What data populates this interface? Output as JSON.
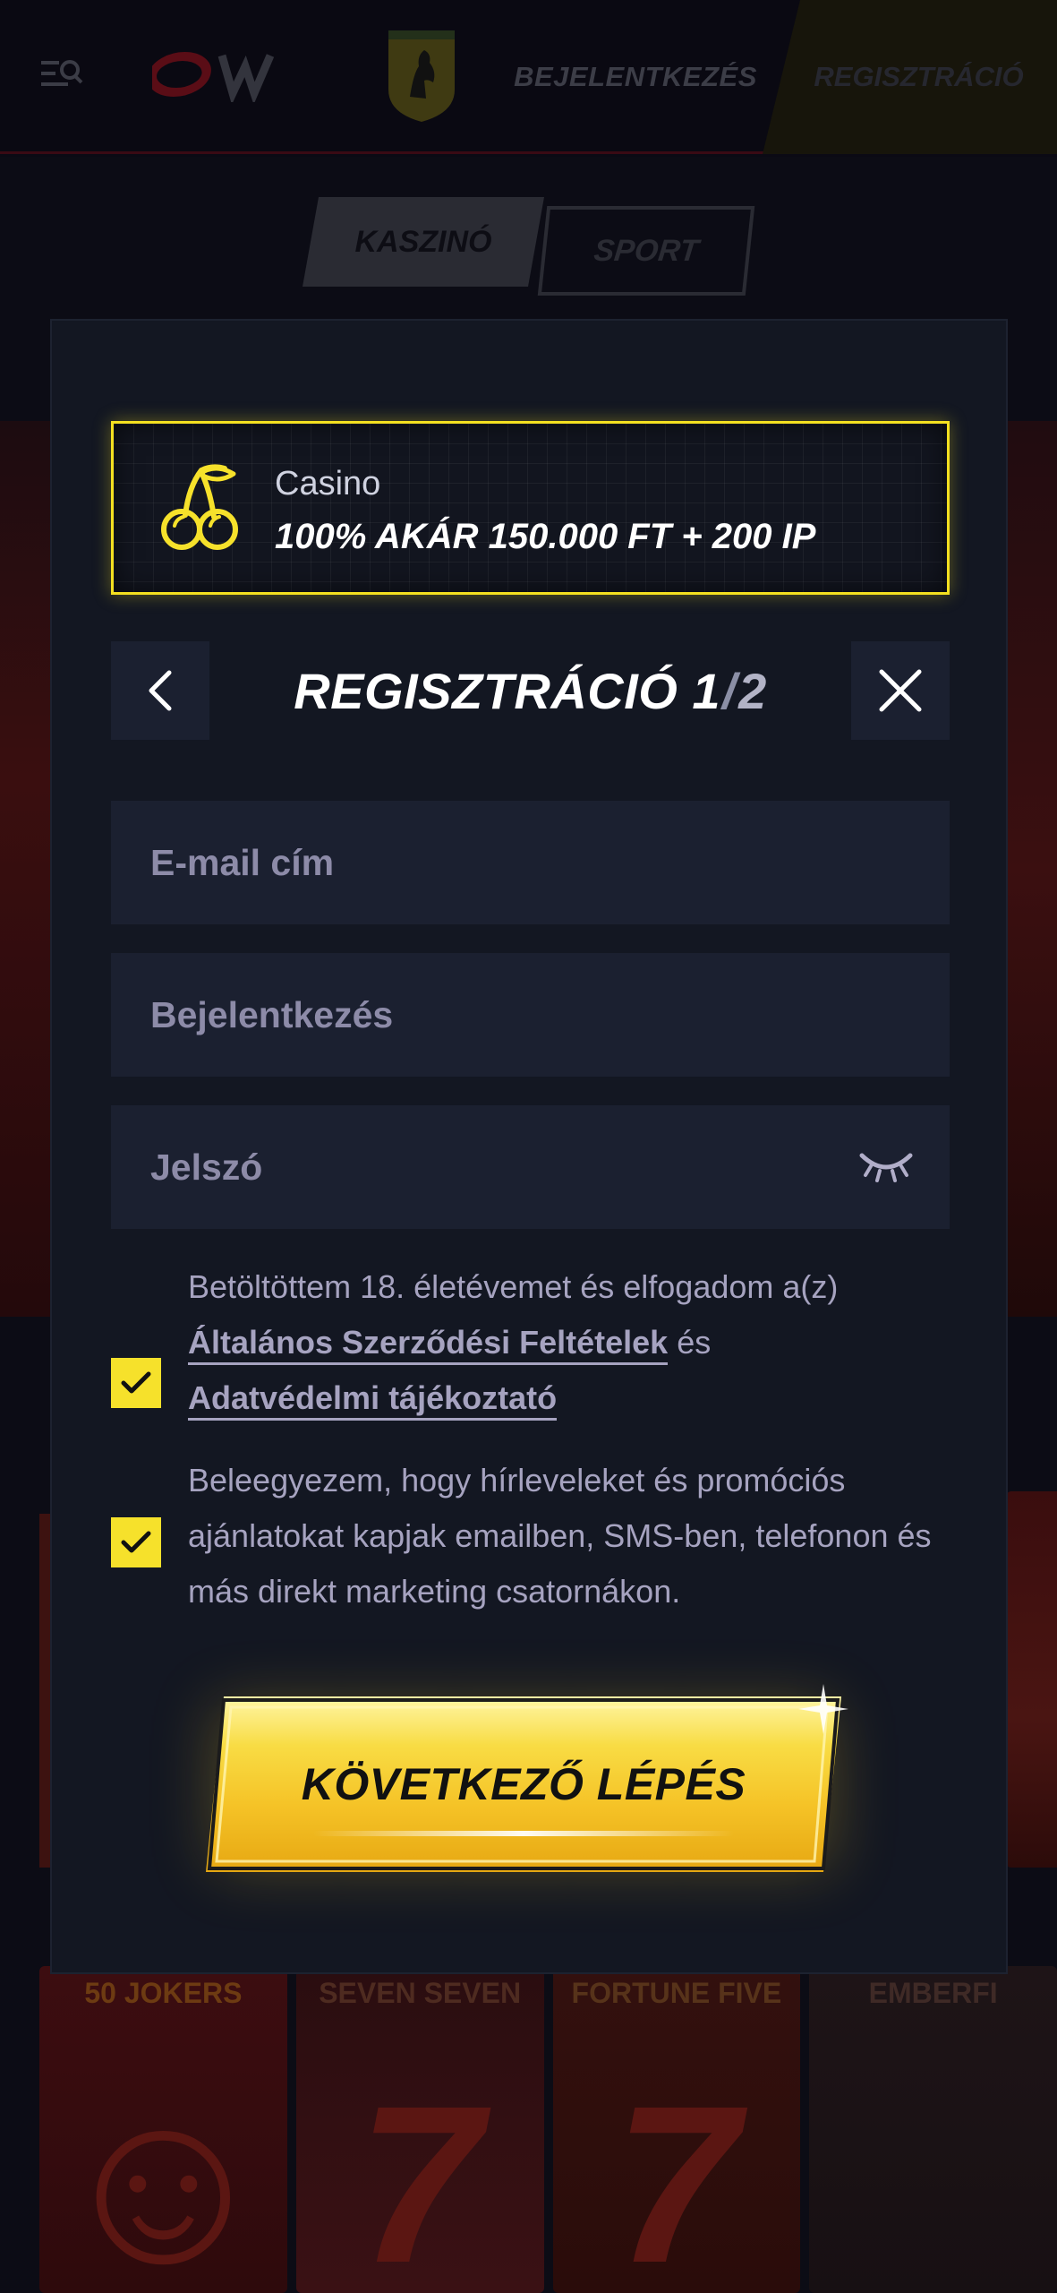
{
  "nav": {
    "login_label": "BEJELENTKEZÉS",
    "register_label": "REGISZTRÁCIÓ"
  },
  "tabs": {
    "casino_label": "KASZINÓ",
    "sport_label": "SPORT"
  },
  "promo": {
    "title": "Casino",
    "offer": "100% AKÁR 150.000 FT + 200 IP",
    "icon": "cherries-icon"
  },
  "modal": {
    "title_prefix": "REGISZTRÁCIÓ 1",
    "title_slash": "/",
    "title_total": "2"
  },
  "form": {
    "email_placeholder": "E-mail cím",
    "login_placeholder": "Bejelentkezés",
    "password_placeholder": "Jelszó"
  },
  "consents": {
    "terms_intro": "Betöltöttem 18. életévemet és elfogadom a(z)",
    "terms_link": "Általános Szerződési Feltételek",
    "terms_and": "és",
    "privacy_link": "Adatvédelmi tájékoztató",
    "terms_checked": true,
    "marketing_text": "Beleegyezem, hogy hírleveleket és promóciós ajánlatokat kapjak emailben, SMS-ben, telefonon és más direkt marketing csatornákon.",
    "marketing_checked": true
  },
  "cta_label": "KÖVETKEZŐ LÉPÉS",
  "background": {
    "games": [
      "50 JOKERS",
      "SEVEN SEVEN",
      "FORTUNE FIVE",
      "EMBERFI"
    ]
  },
  "colors": {
    "accent": "#f6e12b",
    "modal_bg": "#131722",
    "field_bg": "#1b2030",
    "placeholder": "#8d8ba8"
  }
}
